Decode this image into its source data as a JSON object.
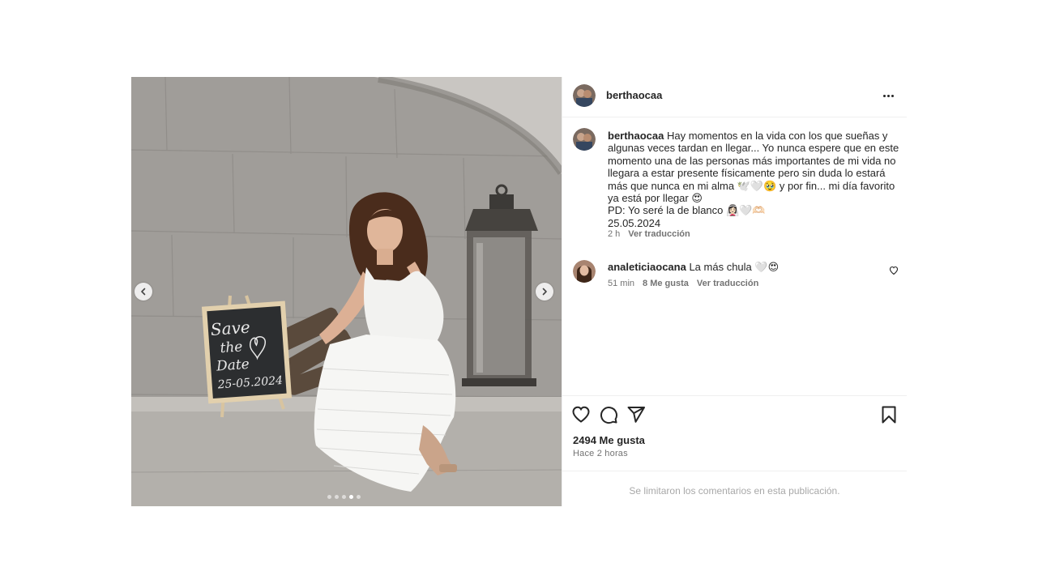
{
  "post": {
    "author": {
      "username": "berthaocaa",
      "avatar_icon": "profile-photo"
    },
    "caption": {
      "username": "berthaocaa",
      "text": "Hay momentos en la vida con los que sueñas y algunas veces tardan en llegar... Yo nunca espere que en este momento una de las personas más importantes de mi vida no llegara a estar presente físicamente pero sin duda lo estará más que nunca en mi alma 🕊️🤍🥹 y por fin... mi día favorito ya está por llegar 😍\nPD: Yo seré la de blanco 👰🏻‍♀️🤍🫶🏻\n25.05.2024",
      "time": "2 h",
      "translate": "Ver traducción"
    },
    "comments": [
      {
        "username": "analeticiaocana",
        "text": "La más chula 🤍😍",
        "time": "51 min",
        "likes": "8 Me gusta",
        "translate": "Ver traducción"
      }
    ],
    "likes": "2494 Me gusta",
    "posted": "Hace 2 horas",
    "comments_limited": "Se limitaron los comentarios en esta publicación.",
    "carousel": {
      "count": 5,
      "active_index": 3
    },
    "chalkboard_text": [
      "Save",
      "the",
      "Date",
      "25-05.2024"
    ]
  },
  "icons": {
    "prev": "chevron-left-icon",
    "next": "chevron-right-icon",
    "more": "more-options-icon",
    "like": "heart-icon",
    "comment": "comment-icon",
    "share": "share-icon",
    "save": "bookmark-icon"
  },
  "colors": {
    "text": "#262626",
    "secondary": "#737373",
    "muted": "#a8a8a8",
    "border": "#efefef"
  }
}
